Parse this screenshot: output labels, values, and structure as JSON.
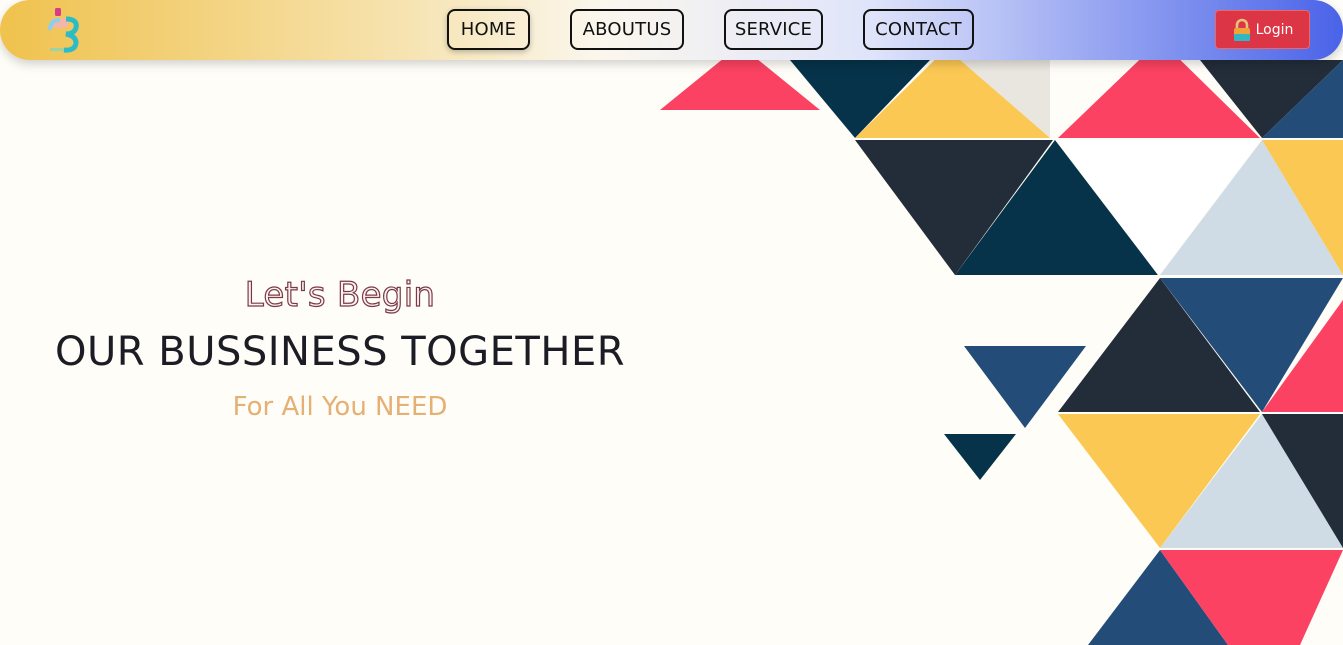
{
  "nav": {
    "items": [
      {
        "label": "HOME",
        "active": true
      },
      {
        "label": "ABOUTUS"
      },
      {
        "label": "SERVICE"
      },
      {
        "label": "CONTACT"
      }
    ],
    "login_label": "Login"
  },
  "hero": {
    "eyebrow": "Let's Begin",
    "title": "OUR BUSSINESS TOGETHER",
    "subtitle": "For All You NEED"
  },
  "colors": {
    "login_red": "#dc3545",
    "navy": "#063349",
    "slate": "#222d39",
    "blue": "#234d78",
    "yellow": "#fcc854",
    "coral": "#fb4262",
    "pale": "#cfdce5",
    "subtitle_tan": "#e5b074"
  },
  "icons": {
    "logo": "brand-logo-icon",
    "lock": "lock-icon"
  }
}
